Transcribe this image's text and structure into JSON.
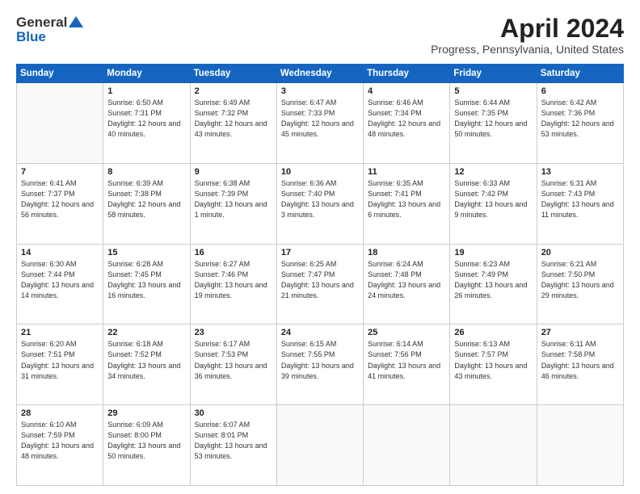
{
  "logo": {
    "general": "General",
    "blue": "Blue"
  },
  "title": {
    "month": "April 2024",
    "location": "Progress, Pennsylvania, United States"
  },
  "headers": [
    "Sunday",
    "Monday",
    "Tuesday",
    "Wednesday",
    "Thursday",
    "Friday",
    "Saturday"
  ],
  "weeks": [
    [
      {
        "num": "",
        "sunrise": "",
        "sunset": "",
        "daylight": ""
      },
      {
        "num": "1",
        "sunrise": "Sunrise: 6:50 AM",
        "sunset": "Sunset: 7:31 PM",
        "daylight": "Daylight: 12 hours and 40 minutes."
      },
      {
        "num": "2",
        "sunrise": "Sunrise: 6:49 AM",
        "sunset": "Sunset: 7:32 PM",
        "daylight": "Daylight: 12 hours and 43 minutes."
      },
      {
        "num": "3",
        "sunrise": "Sunrise: 6:47 AM",
        "sunset": "Sunset: 7:33 PM",
        "daylight": "Daylight: 12 hours and 45 minutes."
      },
      {
        "num": "4",
        "sunrise": "Sunrise: 6:46 AM",
        "sunset": "Sunset: 7:34 PM",
        "daylight": "Daylight: 12 hours and 48 minutes."
      },
      {
        "num": "5",
        "sunrise": "Sunrise: 6:44 AM",
        "sunset": "Sunset: 7:35 PM",
        "daylight": "Daylight: 12 hours and 50 minutes."
      },
      {
        "num": "6",
        "sunrise": "Sunrise: 6:42 AM",
        "sunset": "Sunset: 7:36 PM",
        "daylight": "Daylight: 12 hours and 53 minutes."
      }
    ],
    [
      {
        "num": "7",
        "sunrise": "Sunrise: 6:41 AM",
        "sunset": "Sunset: 7:37 PM",
        "daylight": "Daylight: 12 hours and 56 minutes."
      },
      {
        "num": "8",
        "sunrise": "Sunrise: 6:39 AM",
        "sunset": "Sunset: 7:38 PM",
        "daylight": "Daylight: 12 hours and 58 minutes."
      },
      {
        "num": "9",
        "sunrise": "Sunrise: 6:38 AM",
        "sunset": "Sunset: 7:39 PM",
        "daylight": "Daylight: 13 hours and 1 minute."
      },
      {
        "num": "10",
        "sunrise": "Sunrise: 6:36 AM",
        "sunset": "Sunset: 7:40 PM",
        "daylight": "Daylight: 13 hours and 3 minutes."
      },
      {
        "num": "11",
        "sunrise": "Sunrise: 6:35 AM",
        "sunset": "Sunset: 7:41 PM",
        "daylight": "Daylight: 13 hours and 6 minutes."
      },
      {
        "num": "12",
        "sunrise": "Sunrise: 6:33 AM",
        "sunset": "Sunset: 7:42 PM",
        "daylight": "Daylight: 13 hours and 9 minutes."
      },
      {
        "num": "13",
        "sunrise": "Sunrise: 6:31 AM",
        "sunset": "Sunset: 7:43 PM",
        "daylight": "Daylight: 13 hours and 11 minutes."
      }
    ],
    [
      {
        "num": "14",
        "sunrise": "Sunrise: 6:30 AM",
        "sunset": "Sunset: 7:44 PM",
        "daylight": "Daylight: 13 hours and 14 minutes."
      },
      {
        "num": "15",
        "sunrise": "Sunrise: 6:28 AM",
        "sunset": "Sunset: 7:45 PM",
        "daylight": "Daylight: 13 hours and 16 minutes."
      },
      {
        "num": "16",
        "sunrise": "Sunrise: 6:27 AM",
        "sunset": "Sunset: 7:46 PM",
        "daylight": "Daylight: 13 hours and 19 minutes."
      },
      {
        "num": "17",
        "sunrise": "Sunrise: 6:25 AM",
        "sunset": "Sunset: 7:47 PM",
        "daylight": "Daylight: 13 hours and 21 minutes."
      },
      {
        "num": "18",
        "sunrise": "Sunrise: 6:24 AM",
        "sunset": "Sunset: 7:48 PM",
        "daylight": "Daylight: 13 hours and 24 minutes."
      },
      {
        "num": "19",
        "sunrise": "Sunrise: 6:23 AM",
        "sunset": "Sunset: 7:49 PM",
        "daylight": "Daylight: 13 hours and 26 minutes."
      },
      {
        "num": "20",
        "sunrise": "Sunrise: 6:21 AM",
        "sunset": "Sunset: 7:50 PM",
        "daylight": "Daylight: 13 hours and 29 minutes."
      }
    ],
    [
      {
        "num": "21",
        "sunrise": "Sunrise: 6:20 AM",
        "sunset": "Sunset: 7:51 PM",
        "daylight": "Daylight: 13 hours and 31 minutes."
      },
      {
        "num": "22",
        "sunrise": "Sunrise: 6:18 AM",
        "sunset": "Sunset: 7:52 PM",
        "daylight": "Daylight: 13 hours and 34 minutes."
      },
      {
        "num": "23",
        "sunrise": "Sunrise: 6:17 AM",
        "sunset": "Sunset: 7:53 PM",
        "daylight": "Daylight: 13 hours and 36 minutes."
      },
      {
        "num": "24",
        "sunrise": "Sunrise: 6:15 AM",
        "sunset": "Sunset: 7:55 PM",
        "daylight": "Daylight: 13 hours and 39 minutes."
      },
      {
        "num": "25",
        "sunrise": "Sunrise: 6:14 AM",
        "sunset": "Sunset: 7:56 PM",
        "daylight": "Daylight: 13 hours and 41 minutes."
      },
      {
        "num": "26",
        "sunrise": "Sunrise: 6:13 AM",
        "sunset": "Sunset: 7:57 PM",
        "daylight": "Daylight: 13 hours and 43 minutes."
      },
      {
        "num": "27",
        "sunrise": "Sunrise: 6:11 AM",
        "sunset": "Sunset: 7:58 PM",
        "daylight": "Daylight: 13 hours and 46 minutes."
      }
    ],
    [
      {
        "num": "28",
        "sunrise": "Sunrise: 6:10 AM",
        "sunset": "Sunset: 7:59 PM",
        "daylight": "Daylight: 13 hours and 48 minutes."
      },
      {
        "num": "29",
        "sunrise": "Sunrise: 6:09 AM",
        "sunset": "Sunset: 8:00 PM",
        "daylight": "Daylight: 13 hours and 50 minutes."
      },
      {
        "num": "30",
        "sunrise": "Sunrise: 6:07 AM",
        "sunset": "Sunset: 8:01 PM",
        "daylight": "Daylight: 13 hours and 53 minutes."
      },
      {
        "num": "",
        "sunrise": "",
        "sunset": "",
        "daylight": ""
      },
      {
        "num": "",
        "sunrise": "",
        "sunset": "",
        "daylight": ""
      },
      {
        "num": "",
        "sunrise": "",
        "sunset": "",
        "daylight": ""
      },
      {
        "num": "",
        "sunrise": "",
        "sunset": "",
        "daylight": ""
      }
    ]
  ]
}
